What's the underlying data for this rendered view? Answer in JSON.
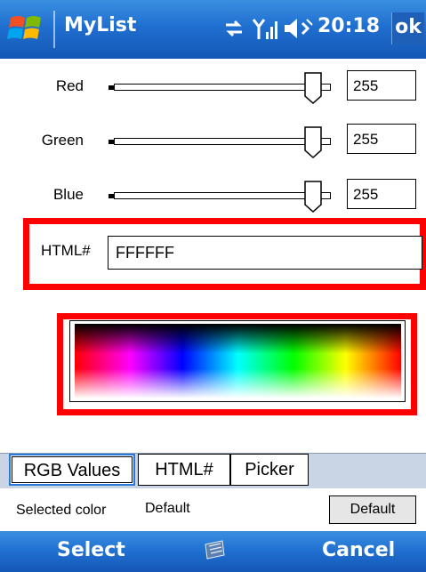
{
  "title_bar": {
    "app_title": "MyList",
    "time": "20:18",
    "ok_label": "ok",
    "icons": [
      "windows-start-icon",
      "connectivity-icon",
      "signal-icon",
      "volume-icon"
    ]
  },
  "sliders": [
    {
      "label": "Red",
      "value": "255",
      "level": 1.0
    },
    {
      "label": "Green",
      "value": "255",
      "level": 1.0
    },
    {
      "label": "Blue",
      "value": "255",
      "level": 1.0
    }
  ],
  "html": {
    "label": "HTML#",
    "value": "FFFFFF"
  },
  "tabs": [
    {
      "label": "RGB Values",
      "active": true
    },
    {
      "label": "HTML#",
      "active": false
    },
    {
      "label": "Picker",
      "active": false
    }
  ],
  "selected": {
    "label": "Selected color",
    "value": "Default",
    "button_label": "Default"
  },
  "softkeys": {
    "left": "Select",
    "right": "Cancel",
    "center_icon": "keyboard-icon"
  },
  "colors": {
    "title_bar": "#1f6fd0",
    "highlight": "#ff0000",
    "tab_strip": "#c9d5e4"
  }
}
